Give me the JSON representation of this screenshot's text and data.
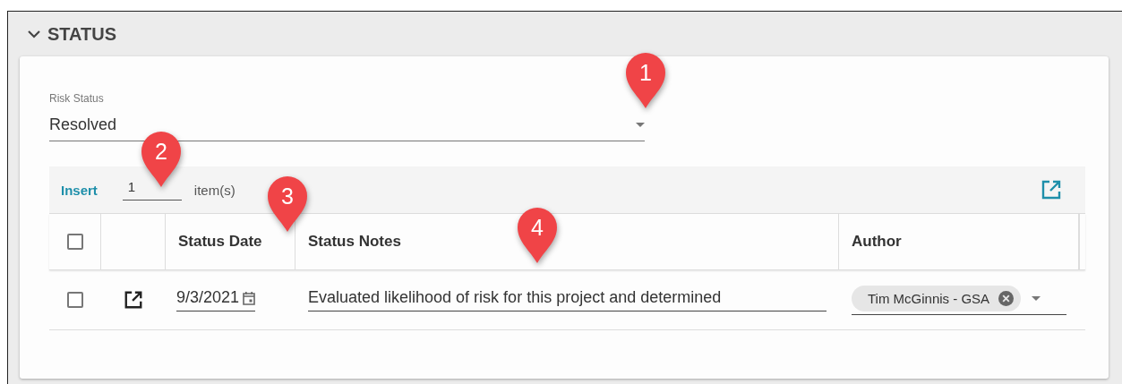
{
  "section": {
    "title": "STATUS",
    "expanded": true
  },
  "risk_status": {
    "label": "Risk Status",
    "value": "Resolved"
  },
  "toolbar": {
    "insert": "Insert",
    "count": "1",
    "unit": "item(s)"
  },
  "table": {
    "header_checked": false,
    "columns": [
      "Status Date",
      "Status Notes",
      "Author"
    ],
    "rows": [
      {
        "checked": false,
        "date": "9/3/2021",
        "notes": "Evaluated likelihood of risk for this project and determined",
        "author": "Tim McGinnis - GSA"
      }
    ]
  },
  "callouts": [
    {
      "label": "1"
    },
    {
      "label": "2"
    },
    {
      "label": "3"
    },
    {
      "label": "4"
    }
  ]
}
